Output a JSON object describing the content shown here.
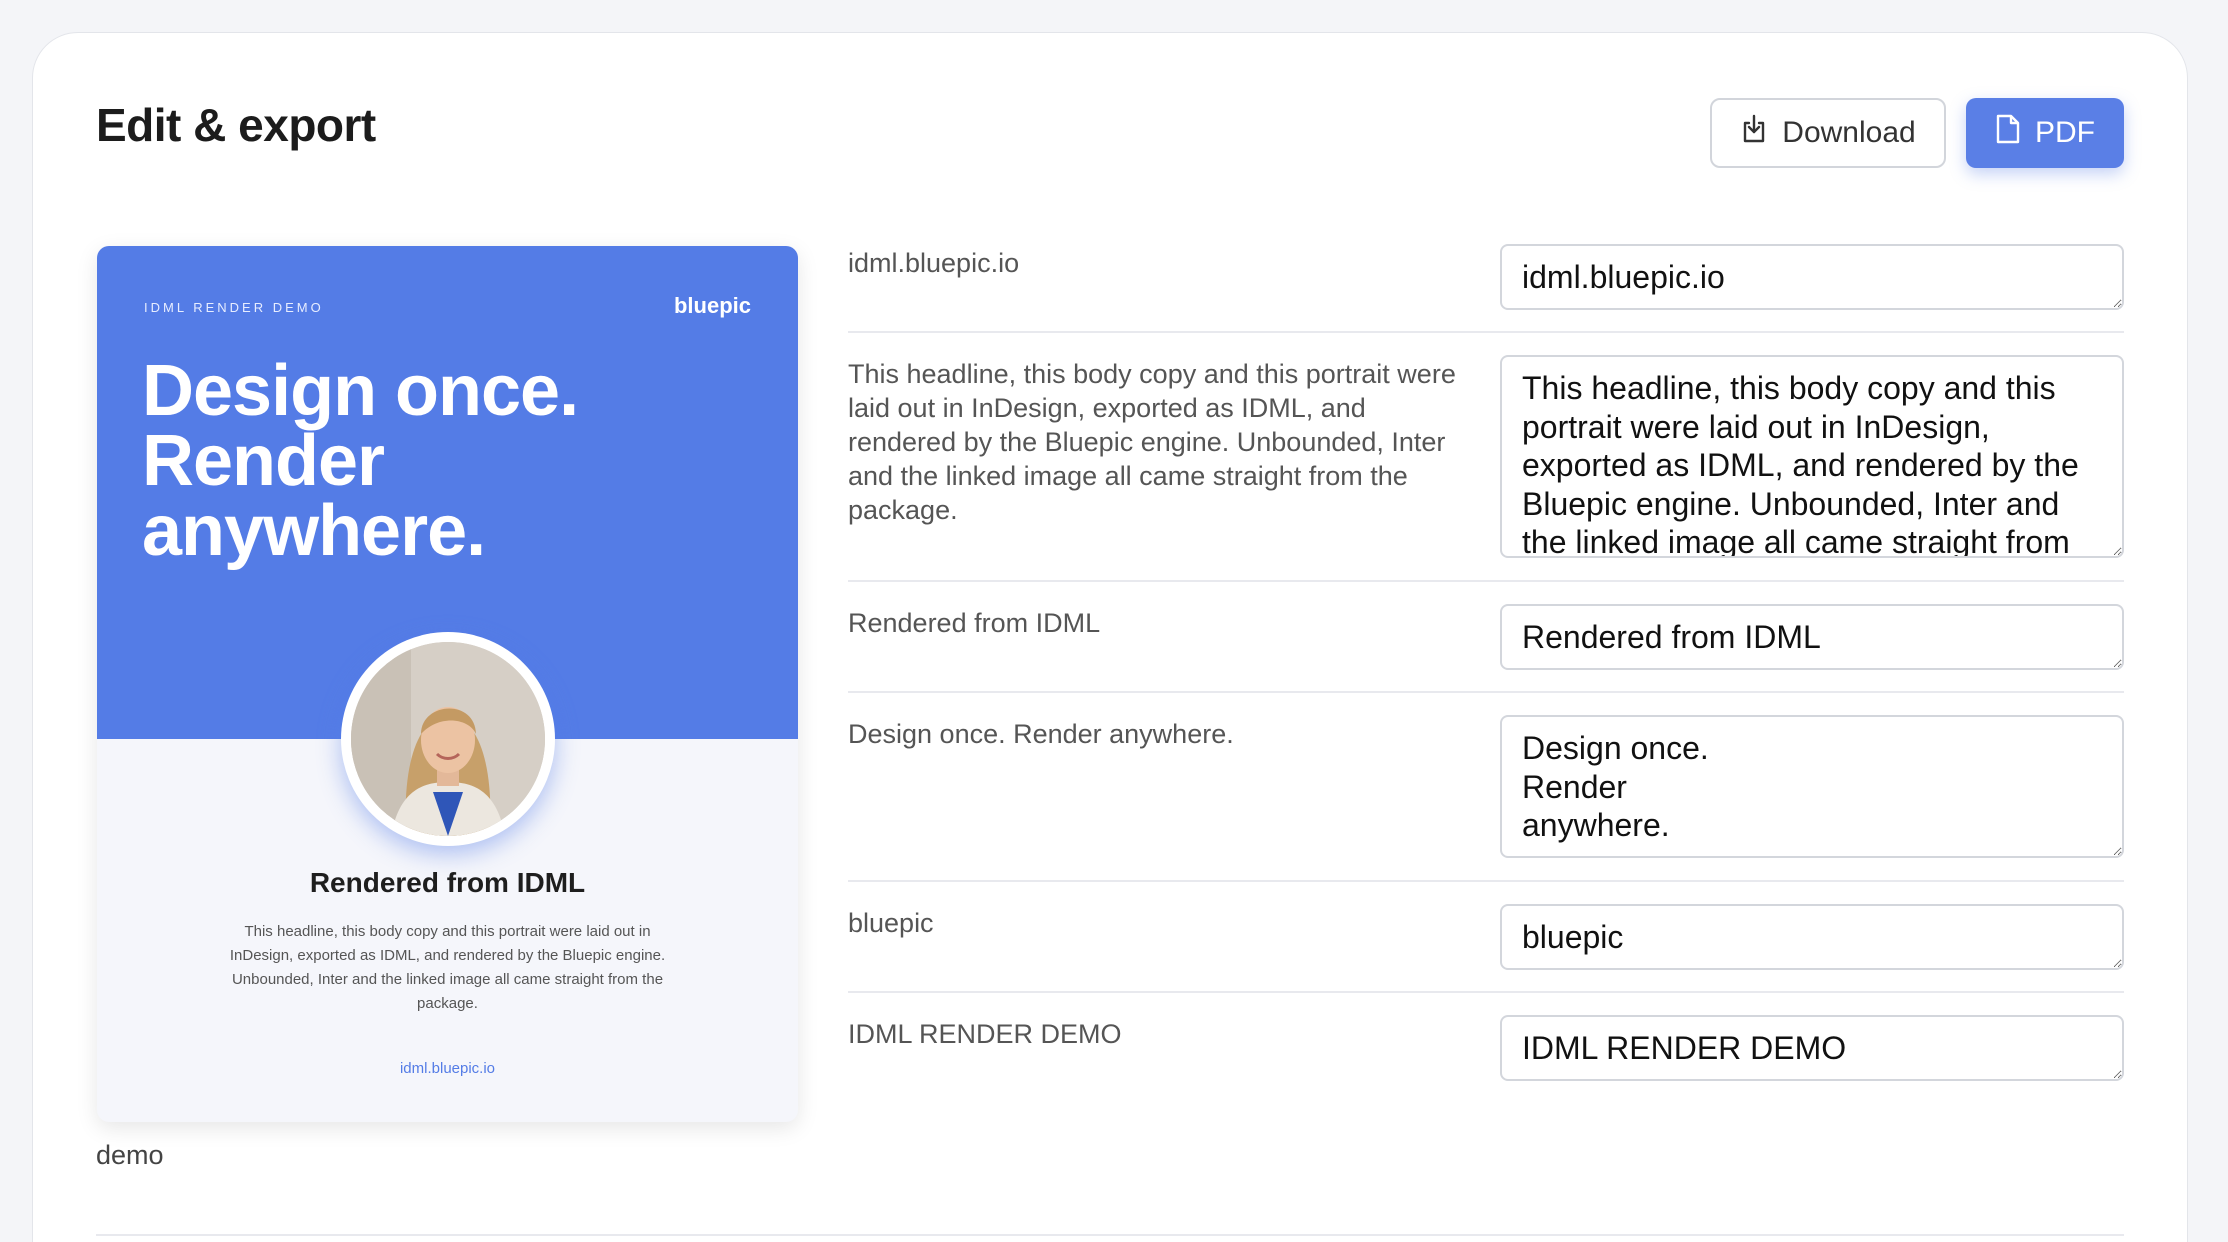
{
  "header": {
    "title": "Edit & export",
    "download_label": "Download",
    "pdf_label": "PDF"
  },
  "poster": {
    "kicker": "IDML RENDER DEMO",
    "brand": "bluepic",
    "headline": "Design once. Render anywhere.",
    "subhead": "Rendered from IDML",
    "body": "This headline, this body copy and this portrait were laid out in InDesign, exported as IDML, and rendered by the Bluepic engine. Unbounded, Inter and the linked image all came straight from the package.",
    "url": "idml.bluepic.io",
    "accent_color": "#547ce6"
  },
  "preview_caption": "demo",
  "fields": [
    {
      "label": "idml.bluepic.io",
      "value": "idml.bluepic.io"
    },
    {
      "label": "This headline, this body copy and this portrait were laid out in InDesign, exported as IDML, and rendered by the Bluepic engine. Unbounded, Inter and the linked image all came straight from the package.",
      "value": "This headline, this body copy and this portrait were laid out in InDesign, exported as IDML, and rendered by the Bluepic engine. Unbounded, Inter and the linked image all came straight from the package."
    },
    {
      "label": "Rendered from IDML",
      "value": "Rendered from IDML"
    },
    {
      "label": "Design once. Render anywhere.",
      "value": "Design once.\nRender\nanywhere."
    },
    {
      "label": "bluepic",
      "value": "bluepic"
    },
    {
      "label": "IDML RENDER DEMO",
      "value": "IDML RENDER DEMO"
    }
  ],
  "colors": {
    "primary_button": "#5a7fe6",
    "page_background": "#f4f5f8"
  }
}
